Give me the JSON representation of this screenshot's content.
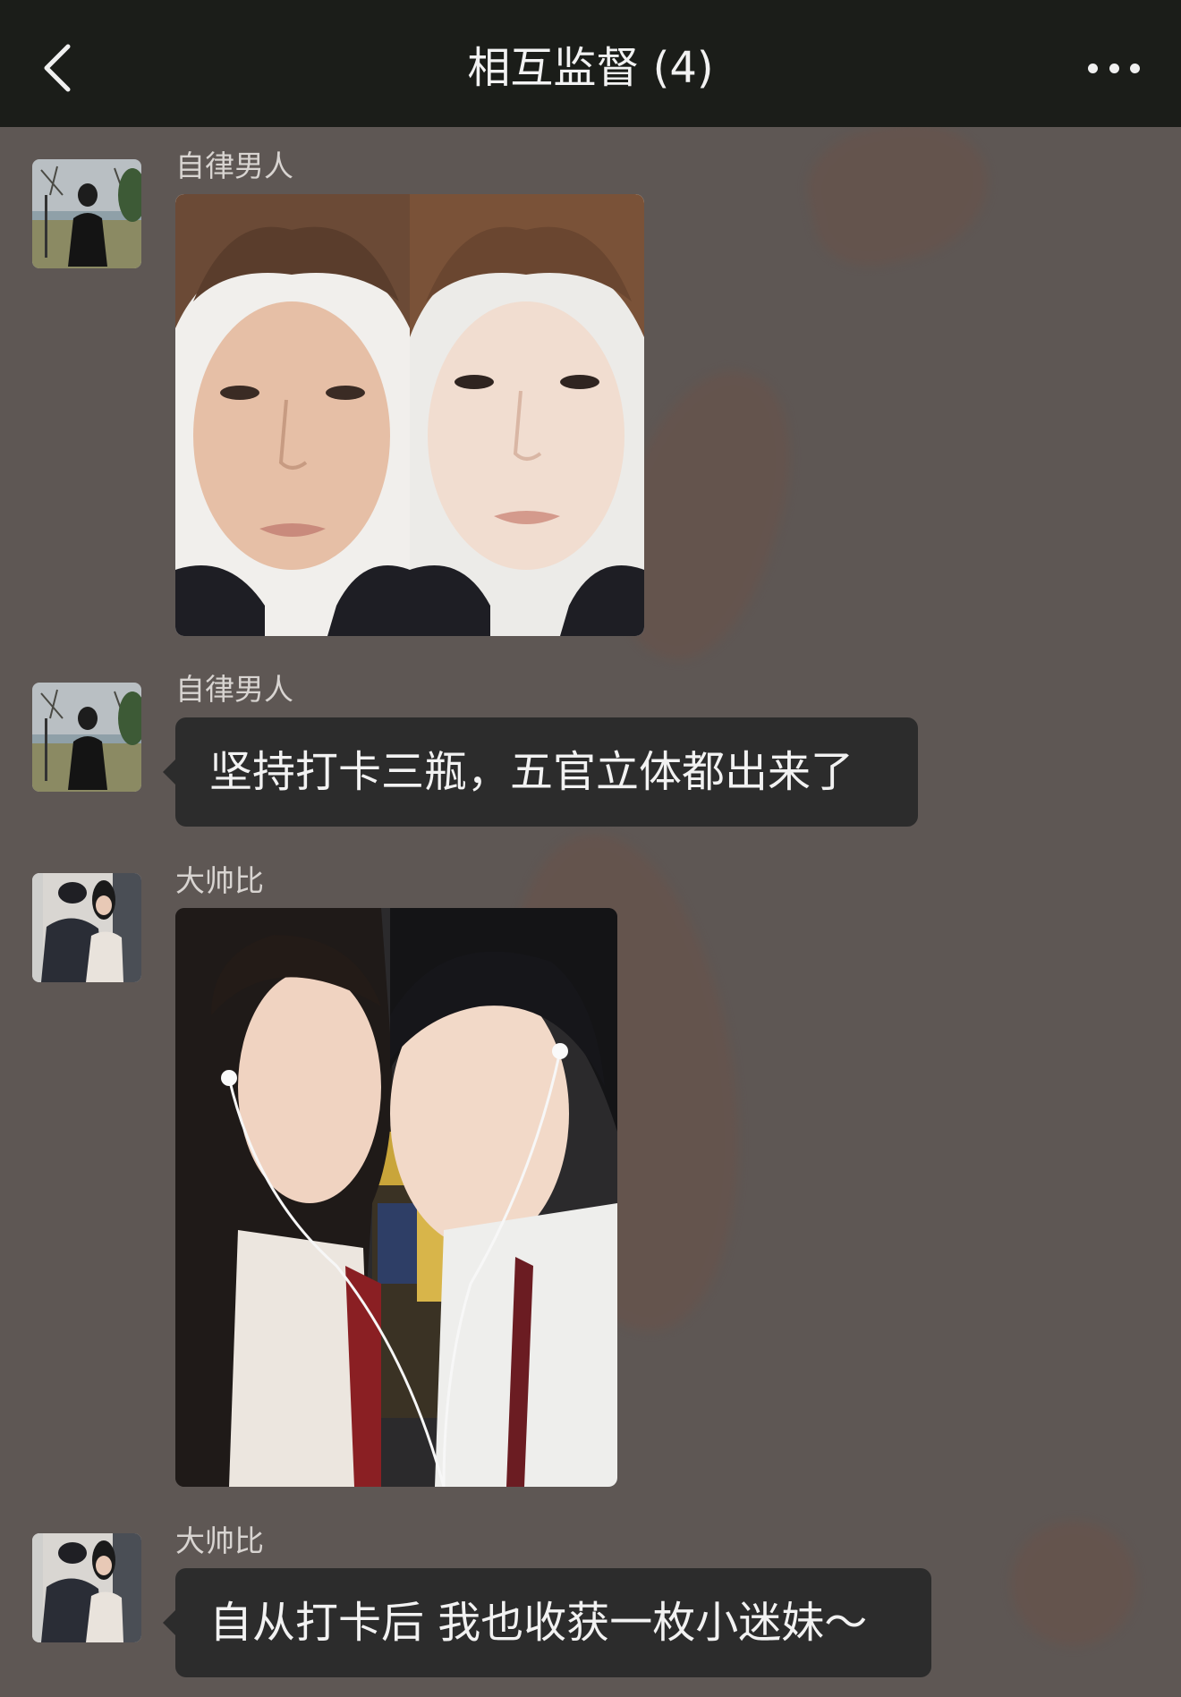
{
  "header": {
    "title": "相互监督 (4)",
    "back_icon": "chevron-left-icon",
    "more_icon": "more-dots-icon"
  },
  "messages": [
    {
      "sender": "自律男人",
      "type": "image",
      "image": "before-after-face-comparison"
    },
    {
      "sender": "自律男人",
      "type": "text",
      "text": "坚持打卡三瓶，五官立体都出来了"
    },
    {
      "sender": "大帅比",
      "type": "image",
      "image": "couple-photo-with-earphones"
    },
    {
      "sender": "大帅比",
      "type": "text",
      "text": "自从打卡后 我也收获一枚小迷妹～"
    }
  ],
  "colors": {
    "header_bg": "#1b1d19",
    "chat_bg": "#5e5754",
    "bubble_bg": "#2c2c2c",
    "bubble_text": "#f2f2f2",
    "sender_text": "#d8d4d1"
  }
}
